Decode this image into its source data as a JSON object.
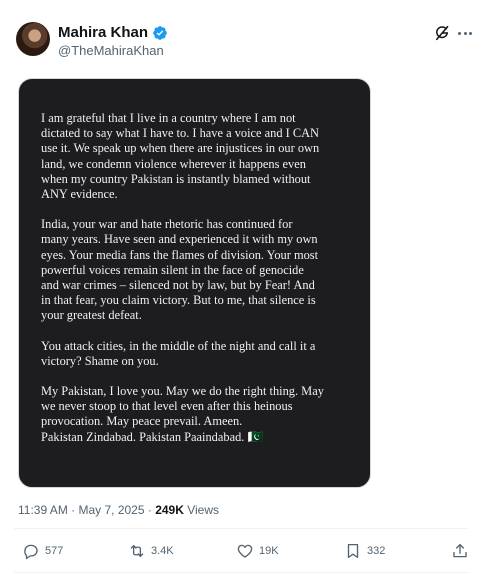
{
  "author": {
    "name": "Mahira Khan",
    "handle": "@TheMahiraKhan"
  },
  "post": {
    "paragraphs": [
      "I am grateful that I live in a country where I am not\ndictated to say what I have to. I have a voice and I CAN\nuse it. We speak up when there are injustices in our own\nland, we condemn violence wherever it happens even\nwhen my country Pakistan is instantly blamed without\nANY evidence.",
      "India, your war and hate rhetoric has continued for\nmany years. Have seen and experienced it with my own\neyes. Your media fans the flames of division. Your most\npowerful voices remain silent in the face of genocide\nand war crimes – silenced not by law, but by Fear! And\nin that fear, you claim victory. But to me, that silence is\nyour greatest defeat.",
      "You attack cities, in the middle of the night and call it a\nvictory? Shame on you.",
      "My Pakistan, I love you. May we do the right thing. May\nwe never stoop to that level even after this heinous\nprovocation. May peace prevail. Ameen.\nPakistan Zindabad. Pakistan Paaindabad. 🇵🇰"
    ],
    "time": "11:39 AM",
    "separator": " · ",
    "date": "May 7, 2025",
    "views_count": "249K",
    "views_label": " Views"
  },
  "actions": {
    "reply_count": "577",
    "repost_count": "3.4K",
    "like_count": "19K",
    "bookmark_count": "332"
  },
  "icons": [
    "verified-badge-icon",
    "grok-icon",
    "more-icon",
    "reply-icon",
    "repost-icon",
    "like-icon",
    "bookmark-icon",
    "share-icon"
  ],
  "colors": {
    "verified": "#1d9bf0",
    "secondary_text": "#536471",
    "media_background": "#1d1d1f"
  }
}
